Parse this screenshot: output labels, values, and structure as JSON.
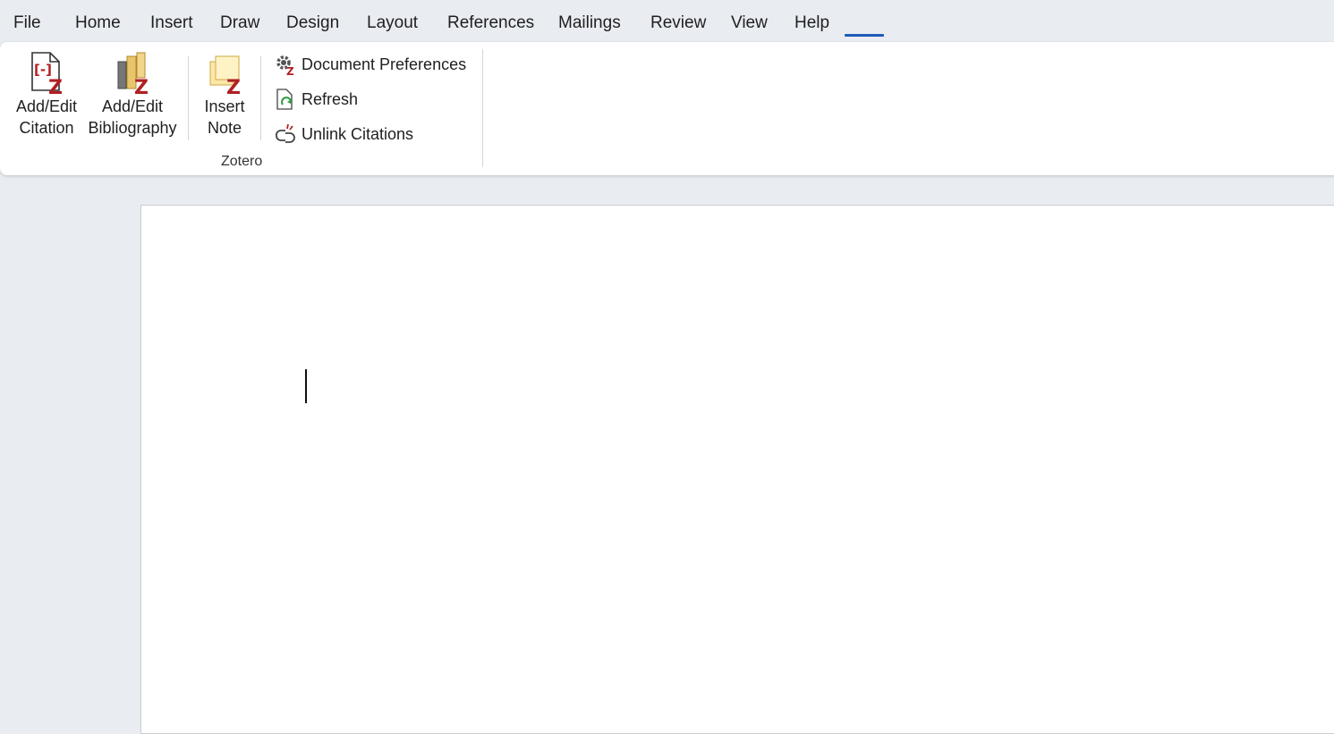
{
  "menu": {
    "tabs": [
      {
        "label": "File"
      },
      {
        "label": "Home"
      },
      {
        "label": "Insert"
      },
      {
        "label": "Draw"
      },
      {
        "label": "Design"
      },
      {
        "label": "Layout"
      },
      {
        "label": "References"
      },
      {
        "label": "Mailings"
      },
      {
        "label": "Review"
      },
      {
        "label": "View"
      },
      {
        "label": "Help"
      }
    ],
    "active_tab_color": "#1f5bb8"
  },
  "ribbon": {
    "group_label": "Zotero",
    "add_edit_citation": {
      "line1": "Add/Edit",
      "line2": "Citation",
      "icon": "citation-icon"
    },
    "add_edit_bibliography": {
      "line1": "Add/Edit",
      "line2": "Bibliography",
      "icon": "bibliography-icon"
    },
    "insert_note": {
      "line1": "Insert",
      "line2": "Note",
      "icon": "note-icon"
    },
    "document_preferences": {
      "label": "Document Preferences",
      "icon": "gear-z-icon"
    },
    "refresh": {
      "label": "Refresh",
      "icon": "refresh-icon"
    },
    "unlink_citations": {
      "label": "Unlink Citations",
      "icon": "unlink-icon"
    }
  },
  "colors": {
    "zotero_red": "#b01f24",
    "background": "#e9ecf1"
  }
}
